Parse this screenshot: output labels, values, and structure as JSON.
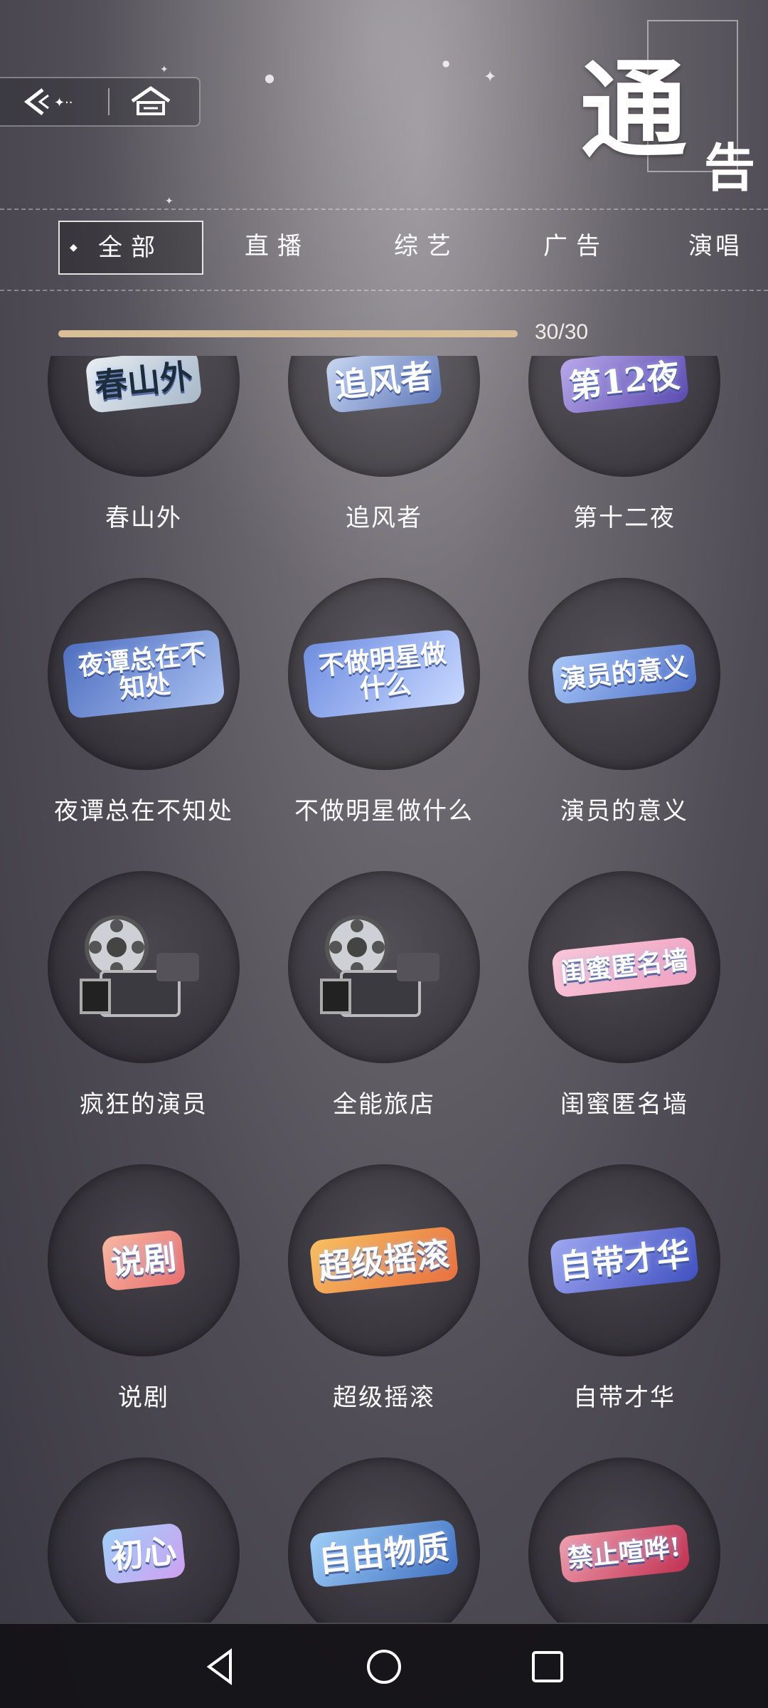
{
  "header": {
    "title_big": "通",
    "title_small": "告"
  },
  "tabs": [
    {
      "label": "全部",
      "active": true
    },
    {
      "label": "直播",
      "active": false
    },
    {
      "label": "综艺",
      "active": false
    },
    {
      "label": "广告",
      "active": false
    },
    {
      "label": "演唱",
      "active": false
    }
  ],
  "progress": {
    "text": "30/30",
    "fraction": 1.0
  },
  "cards": [
    {
      "label": "春山外",
      "logo": "春山外",
      "color": "#1d2d3a"
    },
    {
      "label": "追风者",
      "logo": "追风者",
      "color": "#ffffff"
    },
    {
      "label": "第十二夜",
      "logo": "第12夜",
      "color": "#ffffff"
    },
    {
      "label": "夜谭总在不知处",
      "logo": "夜谭总在不知处",
      "color": "#ffffff"
    },
    {
      "label": "不做明星做什么",
      "logo": "不做明星做什么",
      "color": "#ffffff"
    },
    {
      "label": "演员的意义",
      "logo": "演员的意义",
      "color": "#ffffff"
    },
    {
      "label": "疯狂的演员",
      "logo": "",
      "color": "#ffffff"
    },
    {
      "label": "全能旅店",
      "logo": "",
      "color": "#ffffff"
    },
    {
      "label": "闺蜜匿名墙",
      "logo": "闺蜜匿名墙",
      "color": "#ffffff"
    },
    {
      "label": "说剧",
      "logo": "说剧",
      "color": "#ffffff"
    },
    {
      "label": "超级摇滚",
      "logo": "超级摇滚",
      "color": "#ffffff"
    },
    {
      "label": "自带才华",
      "logo": "自带才华",
      "color": "#ffffff"
    },
    {
      "label": "初心",
      "logo": "初心",
      "color": "#ffffff"
    },
    {
      "label": "自由物质",
      "logo": "自由物质",
      "color": "#ffffff"
    },
    {
      "label": "禁止喧哗",
      "logo": "禁止喧哗!",
      "color": "#ffffff"
    }
  ],
  "icons": {
    "back": "back-arrow-icon",
    "home": "home-icon",
    "nav_back": "triangle-back-icon",
    "nav_home": "circle-home-icon",
    "nav_recents": "square-recents-icon"
  },
  "colors": {
    "accent": "#d8bf98",
    "navbar": "#121116"
  }
}
